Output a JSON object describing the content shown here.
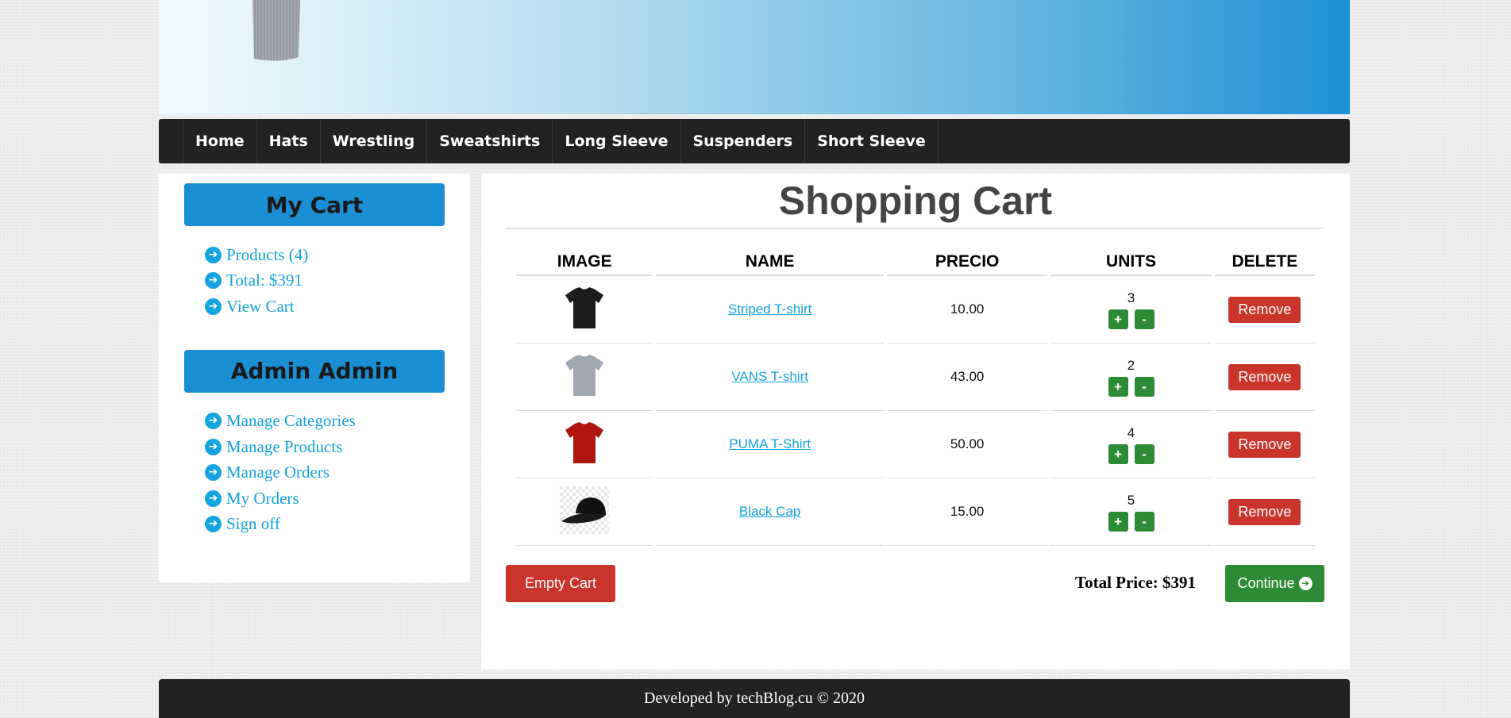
{
  "nav": {
    "items": [
      "Home",
      "Hats",
      "Wrestling",
      "Sweatshirts",
      "Long Sleeve",
      "Suspenders",
      "Short Sleeve"
    ]
  },
  "sidebar": {
    "cart_title": "My Cart",
    "cart_items": [
      "Products (4)",
      "Total: $391",
      "View Cart"
    ],
    "admin_title": "Admin Admin",
    "admin_items": [
      "Manage Categories",
      "Manage Products",
      "Manage Orders",
      "My Orders",
      "Sign off"
    ]
  },
  "cart": {
    "title": "Shopping Cart",
    "headers": [
      "IMAGE",
      "NAME",
      "PRECIO",
      "UNITS",
      "DELETE"
    ],
    "rows": [
      {
        "name": "Striped T-shirt",
        "price": "10.00",
        "units": "3",
        "image": "black-tshirt",
        "color": "#1c1c1c"
      },
      {
        "name": "VANS T-shirt",
        "price": "43.00",
        "units": "2",
        "image": "gray-tshirt",
        "color": "#a3a7b2"
      },
      {
        "name": "PUMA T-Shirt",
        "price": "50.00",
        "units": "4",
        "image": "red-tshirt",
        "color": "#b01510"
      },
      {
        "name": "Black Cap",
        "price": "15.00",
        "units": "5",
        "image": "black-cap",
        "color": "#111111"
      }
    ],
    "plus_label": "+",
    "minus_label": "-",
    "remove_label": "Remove",
    "empty_label": "Empty Cart",
    "total_label": "Total Price: $391",
    "continue_label": "Continue"
  },
  "footer": {
    "text": "Developed by techBlog.cu © 2020"
  }
}
